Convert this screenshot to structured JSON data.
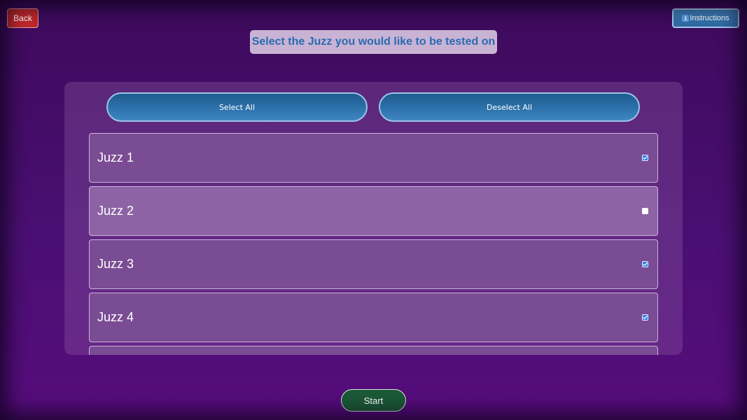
{
  "header": {
    "back_label": "Back",
    "instructions_label": "Instructions",
    "instructions_icon": "info-icon",
    "title": "Select the Juzz you would like to be tested on"
  },
  "controls": {
    "select_all_label": "Select All",
    "deselect_all_label": "Deselect All"
  },
  "juzz_list": {
    "items": [
      {
        "label": "Juzz 1",
        "checked": true
      },
      {
        "label": "Juzz 2",
        "checked": false
      },
      {
        "label": "Juzz 3",
        "checked": true
      },
      {
        "label": "Juzz 4",
        "checked": true
      },
      {
        "label": "",
        "checked": null
      }
    ]
  },
  "footer": {
    "start_label": "Start"
  },
  "colors": {
    "background": "#4a0f72",
    "back_button": "#c0282c",
    "title_text": "#2a6bb0",
    "pill_button": "#2d72ab",
    "checkbox_checked": "#2a7ce8",
    "start_button": "#1c5a37"
  }
}
